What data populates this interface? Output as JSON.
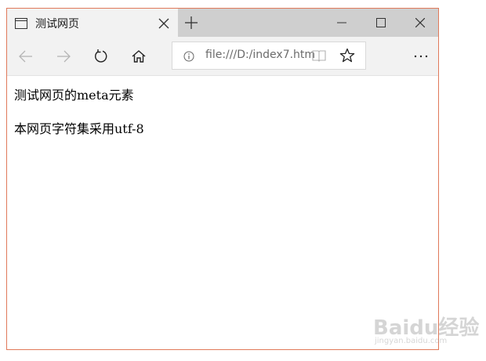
{
  "tab": {
    "title": "测试网页"
  },
  "navbar": {
    "address_url": "file:///D:/index7.htm",
    "more_label": "···"
  },
  "content": {
    "line1": "测试网页的meta元素",
    "line2": "本网页字符集采用utf-8"
  },
  "watermark": {
    "logo_text": "Baidu经验",
    "sub_text": "jingyan.baidu.com"
  },
  "colors": {
    "window_border": "#e0795a",
    "tabbar_bg": "#cfcfcf",
    "active_tab_bg": "#f2f2f2",
    "address_text": "#6b6b6b"
  }
}
